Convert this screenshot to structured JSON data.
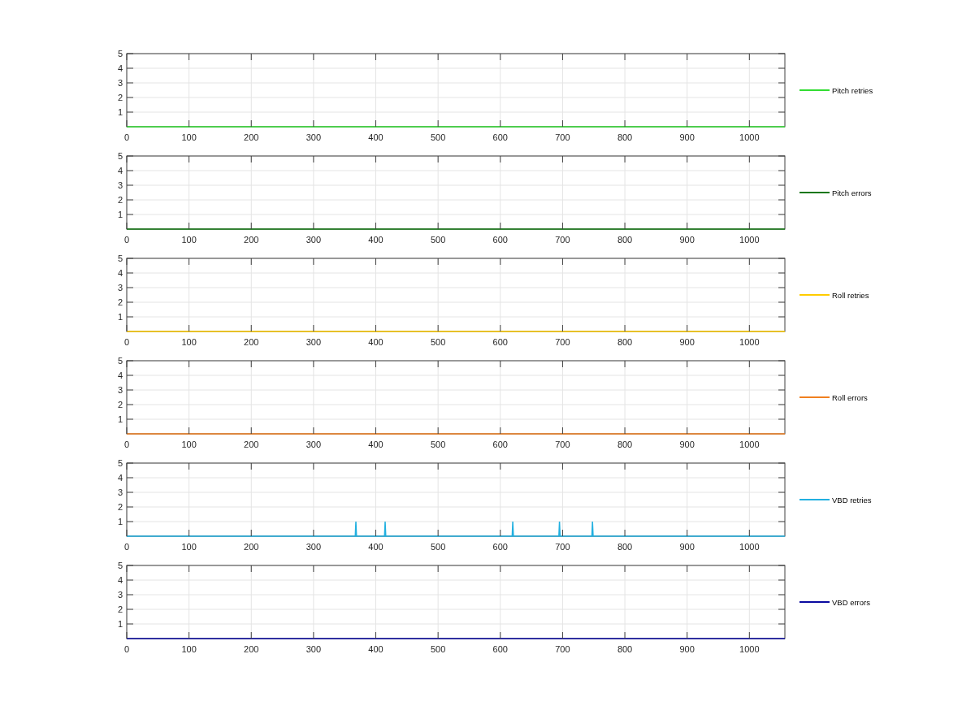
{
  "charts": [
    {
      "chart_data": {
        "type": "line",
        "x": [
          0,
          1057
        ],
        "series": [
          {
            "name": "Pitch retries",
            "color": "#33dd33",
            "values": [
              0,
              0
            ]
          }
        ],
        "xlim": [
          0,
          1057
        ],
        "ylim": [
          0,
          5
        ],
        "xticks": [
          0,
          100,
          200,
          300,
          400,
          500,
          600,
          700,
          800,
          900,
          1000
        ],
        "yticks": [
          1,
          2,
          3,
          4,
          5
        ],
        "grid": true
      }
    },
    {
      "chart_data": {
        "type": "line",
        "x": [
          0,
          1057
        ],
        "series": [
          {
            "name": "Pitch errors",
            "color": "#117711",
            "values": [
              0,
              0
            ]
          }
        ],
        "xlim": [
          0,
          1057
        ],
        "ylim": [
          0,
          5
        ],
        "xticks": [
          0,
          100,
          200,
          300,
          400,
          500,
          600,
          700,
          800,
          900,
          1000
        ],
        "yticks": [
          1,
          2,
          3,
          4,
          5
        ],
        "grid": true
      }
    },
    {
      "chart_data": {
        "type": "line",
        "x": [
          0,
          1057
        ],
        "series": [
          {
            "name": "Roll retries",
            "color": "#ffcc00",
            "values": [
              0,
              0
            ]
          }
        ],
        "xlim": [
          0,
          1057
        ],
        "ylim": [
          0,
          5
        ],
        "xticks": [
          0,
          100,
          200,
          300,
          400,
          500,
          600,
          700,
          800,
          900,
          1000
        ],
        "yticks": [
          1,
          2,
          3,
          4,
          5
        ],
        "grid": true
      }
    },
    {
      "chart_data": {
        "type": "line",
        "x": [
          0,
          1057
        ],
        "series": [
          {
            "name": "Roll errors",
            "color": "#f08020",
            "values": [
              0,
              0
            ]
          }
        ],
        "xlim": [
          0,
          1057
        ],
        "ylim": [
          0,
          5
        ],
        "xticks": [
          0,
          100,
          200,
          300,
          400,
          500,
          600,
          700,
          800,
          900,
          1000
        ],
        "yticks": [
          1,
          2,
          3,
          4,
          5
        ],
        "grid": true
      }
    },
    {
      "chart_data": {
        "type": "line",
        "x": [
          0,
          367,
          368,
          369,
          414,
          415,
          416,
          619,
          620,
          621,
          694,
          695,
          696,
          747,
          748,
          749,
          1057
        ],
        "series": [
          {
            "name": "VBD retries",
            "color": "#22b0e0",
            "values": [
              0,
              0,
              1,
              0,
              0,
              1,
              0,
              0,
              1,
              0,
              0,
              1,
              0,
              0,
              1,
              0,
              0
            ]
          }
        ],
        "xlim": [
          0,
          1057
        ],
        "ylim": [
          0,
          5
        ],
        "xticks": [
          0,
          100,
          200,
          300,
          400,
          500,
          600,
          700,
          800,
          900,
          1000
        ],
        "yticks": [
          1,
          2,
          3,
          4,
          5
        ],
        "grid": true
      }
    },
    {
      "chart_data": {
        "type": "line",
        "x": [
          0,
          1057
        ],
        "series": [
          {
            "name": "VBD errors",
            "color": "#0a0aa0",
            "values": [
              0,
              0
            ]
          }
        ],
        "xlim": [
          0,
          1057
        ],
        "ylim": [
          0,
          5
        ],
        "xticks": [
          0,
          100,
          200,
          300,
          400,
          500,
          600,
          700,
          800,
          900,
          1000
        ],
        "yticks": [
          1,
          2,
          3,
          4,
          5
        ],
        "grid": true
      }
    }
  ]
}
